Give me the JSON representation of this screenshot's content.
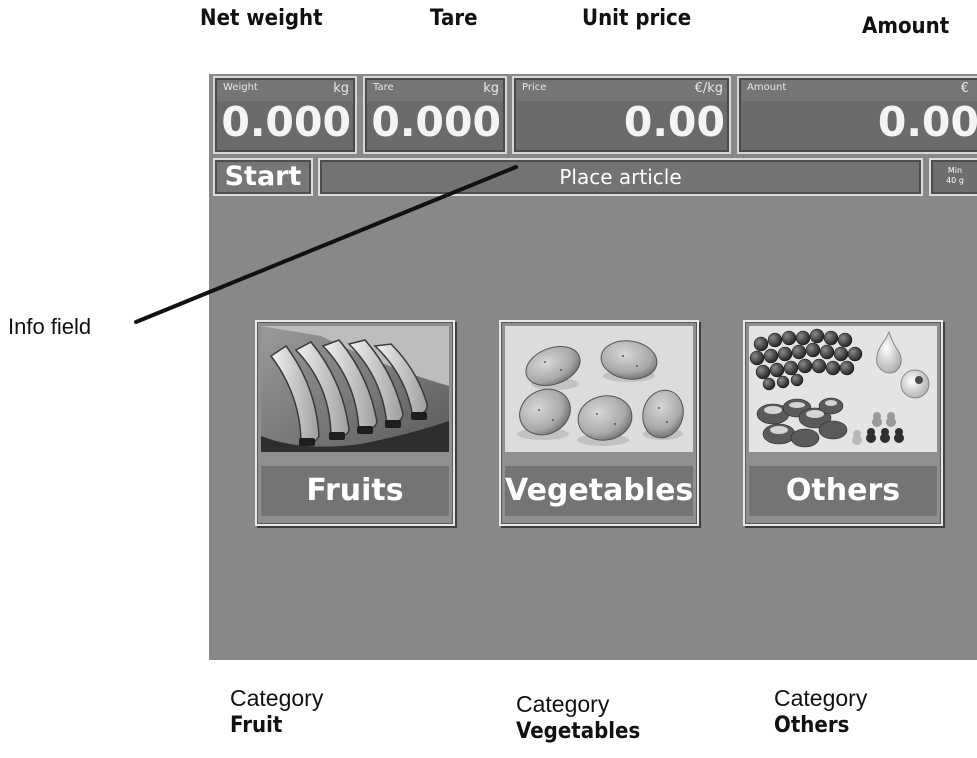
{
  "header_labels": {
    "net_weight": "Net weight",
    "tare": "Tare",
    "unit_price": "Unit price",
    "amount": "Amount"
  },
  "displays": {
    "weight": {
      "title": "Weight",
      "unit": "kg",
      "value": "0.000"
    },
    "tare": {
      "title": "Tare",
      "unit": "kg",
      "value": "0.000"
    },
    "price": {
      "title": "Price",
      "unit": "€/kg",
      "value": "0.00"
    },
    "amount": {
      "title": "Amount",
      "unit": "€",
      "value": "0.00"
    }
  },
  "controls": {
    "start_label": "Start",
    "info_text": "Place article",
    "min_line1": "Min",
    "min_line2": "40 g"
  },
  "tiles": [
    {
      "label": "Fruits"
    },
    {
      "label": "Vegetables"
    },
    {
      "label": "Others"
    }
  ],
  "annotations": {
    "info_field": "Info field",
    "categories": [
      {
        "prefix": "Category",
        "name": "Fruit"
      },
      {
        "prefix": "Category",
        "name": "Vegetables"
      },
      {
        "prefix": "Category",
        "name": "Others"
      }
    ]
  },
  "colors": {
    "screen_bg": "#888888",
    "display_bg": "#6b6b6b",
    "display_text": "#f4f4f4"
  }
}
